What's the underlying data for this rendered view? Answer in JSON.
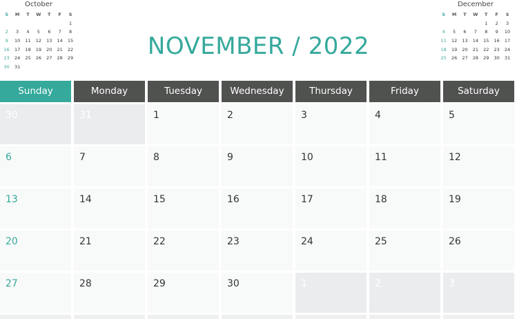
{
  "title": "NOVEMBER / 2022",
  "weekdays": [
    "Sunday",
    "Monday",
    "Tuesday",
    "Wednesday",
    "Thursday",
    "Friday",
    "Saturday"
  ],
  "mini_prev": {
    "month": "October",
    "days_header": [
      "S",
      "M",
      "T",
      "W",
      "T",
      "F",
      "S"
    ],
    "weeks": [
      [
        "",
        "",
        "",
        "",
        "",
        "",
        "1"
      ],
      [
        "2",
        "3",
        "4",
        "5",
        "6",
        "7",
        "8"
      ],
      [
        "9",
        "10",
        "11",
        "12",
        "13",
        "14",
        "15"
      ],
      [
        "16",
        "17",
        "18",
        "19",
        "20",
        "21",
        "22"
      ],
      [
        "23",
        "24",
        "25",
        "26",
        "27",
        "28",
        "29"
      ],
      [
        "30",
        "31",
        "",
        "",
        "",
        "",
        ""
      ]
    ]
  },
  "mini_next": {
    "month": "December",
    "days_header": [
      "S",
      "M",
      "T",
      "W",
      "T",
      "F",
      "S"
    ],
    "weeks": [
      [
        "",
        "",
        "",
        "",
        "1",
        "2",
        "3"
      ],
      [
        "4",
        "5",
        "6",
        "7",
        "8",
        "9",
        "10"
      ],
      [
        "11",
        "12",
        "13",
        "14",
        "15",
        "16",
        "17"
      ],
      [
        "18",
        "19",
        "20",
        "21",
        "22",
        "23",
        "24"
      ],
      [
        "25",
        "26",
        "27",
        "28",
        "29",
        "30",
        "31"
      ]
    ]
  },
  "weeks": [
    [
      {
        "d": "30",
        "out": true
      },
      {
        "d": "31",
        "out": true
      },
      {
        "d": "1"
      },
      {
        "d": "2"
      },
      {
        "d": "3"
      },
      {
        "d": "4"
      },
      {
        "d": "5"
      }
    ],
    [
      {
        "d": "6"
      },
      {
        "d": "7"
      },
      {
        "d": "8"
      },
      {
        "d": "9"
      },
      {
        "d": "10"
      },
      {
        "d": "11"
      },
      {
        "d": "12"
      }
    ],
    [
      {
        "d": "13"
      },
      {
        "d": "14"
      },
      {
        "d": "15"
      },
      {
        "d": "16"
      },
      {
        "d": "17"
      },
      {
        "d": "18"
      },
      {
        "d": "19"
      }
    ],
    [
      {
        "d": "20"
      },
      {
        "d": "21"
      },
      {
        "d": "22"
      },
      {
        "d": "23"
      },
      {
        "d": "24"
      },
      {
        "d": "25"
      },
      {
        "d": "26"
      }
    ],
    [
      {
        "d": "27"
      },
      {
        "d": "28"
      },
      {
        "d": "29"
      },
      {
        "d": "30"
      },
      {
        "d": "1",
        "out": true
      },
      {
        "d": "2",
        "out": true
      },
      {
        "d": "3",
        "out": true
      }
    ]
  ],
  "colors": {
    "accent": "#35a99c",
    "header": "#505250",
    "cell": "#f8f9f9",
    "outside": "#ebecee"
  }
}
